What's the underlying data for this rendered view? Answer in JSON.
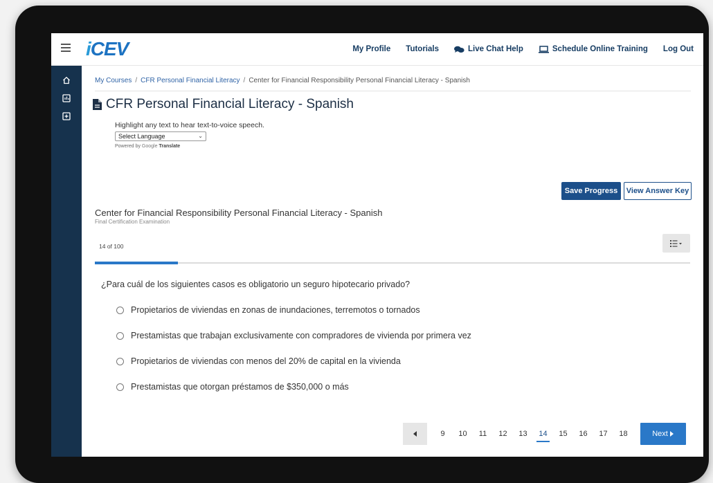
{
  "brand": {
    "logo_text_i": "i",
    "logo_text_rest": "CEV"
  },
  "nav": {
    "my_profile": "My Profile",
    "tutorials": "Tutorials",
    "live_chat": "Live Chat Help",
    "schedule": "Schedule Online Training",
    "logout": "Log Out"
  },
  "breadcrumb": {
    "items": [
      "My Courses",
      "CFR Personal Financial Literacy",
      "Center for Financial Responsibility Personal Financial Literacy - Spanish"
    ],
    "separator": "/"
  },
  "page": {
    "title": "CFR Personal Financial Literacy - Spanish"
  },
  "tts": {
    "hint": "Highlight any text to hear text-to-voice speech.",
    "select_value": "Select Language",
    "powered_prefix": "Powered by",
    "powered_google": "Google",
    "powered_translate": "Translate"
  },
  "actions": {
    "save": "Save Progress",
    "answer_key": "View Answer Key"
  },
  "exam": {
    "title": "Center for Financial Responsibility Personal Financial Literacy - Spanish",
    "subtitle": "Final Certification Examination",
    "counter": "14 of 100",
    "progress_fraction": 0.14
  },
  "question": {
    "text": "¿Para cuál de los siguientes casos es obligatorio un seguro hipotecario privado?",
    "options": [
      "Propietarios de viviendas en zonas de inundaciones, terremotos o tornados",
      "Prestamistas que trabajan exclusivamente con compradores de vivienda por primera vez",
      "Propietarios de viviendas con menos del 20% de capital en la vivienda",
      "Prestamistas que otorgan préstamos de $350,000 o más"
    ]
  },
  "pagination": {
    "pages": [
      "9",
      "10",
      "11",
      "12",
      "13",
      "14",
      "15",
      "16",
      "17",
      "18"
    ],
    "current": "14",
    "next_label": "Next"
  },
  "icons": {
    "menu": "hamburger-icon",
    "chat": "chat-bubbles-icon",
    "monitor": "laptop-icon",
    "document": "document-icon",
    "list": "list-icon",
    "prev": "caret-left-icon",
    "next": "caret-right-icon"
  },
  "colors": {
    "brand_blue": "#1d73c2",
    "sidebar": "#16324d",
    "button_primary": "#1c4f8a",
    "accent": "#2a78c8"
  }
}
